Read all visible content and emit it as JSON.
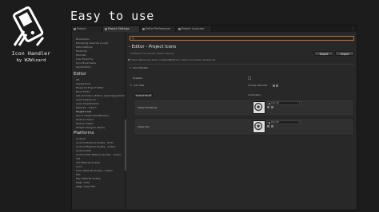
{
  "headline": "Easy to use",
  "brand": {
    "title": "Icon Handler",
    "subtitle": "by W2Wizard",
    "logo_icon": "phone-card-icon"
  },
  "window": {
    "tabs": [
      {
        "label": "Project",
        "icon": "folder-icon",
        "active": false
      },
      {
        "label": "Project Settings",
        "icon": "gear-icon",
        "active": true
      },
      {
        "label": "Editor Preferences",
        "icon": "gear-icon",
        "active": false
      },
      {
        "label": "Project Launcher",
        "icon": "rocket-icon",
        "active": false
      }
    ],
    "tab_menu_glyph": "⋮",
    "search": {
      "placeholder": ""
    }
  },
  "sidebar": {
    "top_items": [
      "Bookmarks",
      "Rendering Override (Local)",
      "Data Settings",
      "Proximity",
      "Tutorials",
      "Low Hierarchy",
      "Sync Bookmarks",
      "Serialization"
    ],
    "sections": [
      {
        "header": "Editor",
        "items": [
          "2D",
          "Appearance",
          "Blueprint Project Editor",
          "Block Editor",
          "Get Animation (Editor) Asset Upgradation",
          "Level Sequencer",
          "Level Simplification",
          "Paper2D - Import",
          "Project Icons",
          "Struct Viewer Simplification",
          "Texture Import",
          "Texture Viewer",
          "Widget Designer (Team)"
        ],
        "active": "Project Icons"
      },
      {
        "header": "Platforms",
        "items": [
          "Android",
          "Android Material Quality - ES31",
          "Android Material Quality - Vulkan",
          "Android SDK",
          "Android SDK Material Quality - Vulkan",
          "iOS",
          "iOS Material Quality",
          "Linux",
          "Linux Material Quality - Vulkan",
          "Mac",
          "Mac Material Quality",
          "Magic Leap",
          "Magic Leap SDK"
        ]
      }
    ]
  },
  "main": {
    "title": "- Editor - Project Icons",
    "subtitle": "Configure icon handler project settings",
    "export_label": "Export",
    "import_label": "Import",
    "note": "These settings are saved in DefaultEditor.ini, which is currently checked out",
    "section_label": "Icon Handler",
    "enabled_label": "Enabled",
    "size_label": "Icon Size",
    "size_value": "2 Array elements",
    "dropdown_value": "Default Mode",
    "dropdown_label": "2 members",
    "rows": [
      {
        "label": "Class Thumbnail",
        "asset": "Icon 16"
      },
      {
        "label": "Class Icon",
        "asset": "Icon 20"
      }
    ]
  }
}
